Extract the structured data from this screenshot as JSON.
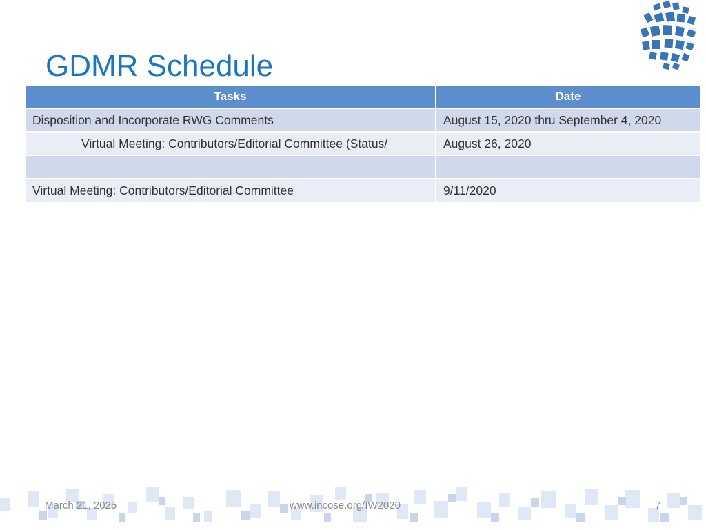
{
  "slide": {
    "title": "GDMR Schedule"
  },
  "table": {
    "headers": {
      "tasks": "Tasks",
      "date": "Date"
    },
    "rows": [
      {
        "task": "Disposition and Incorporate RWG Comments",
        "date": "August 15, 2020 thru September 4, 2020"
      },
      {
        "task": "Virtual Meeting: Contributors/Editorial Committee (Status/",
        "date": "August 26, 2020"
      },
      {
        "task": "",
        "date": ""
      },
      {
        "task": "Virtual Meeting: Contributors/Editorial Committee",
        "date": "9/11/2020"
      }
    ]
  },
  "footer": {
    "date": "March 21, 2025",
    "url": "www.incose.org/IW2020",
    "page_number": "7"
  },
  "colors": {
    "title": "#1a75c4",
    "header_bg": "#5b8ecb",
    "row_odd": "#d0d9eb",
    "row_even": "#e9edf6"
  },
  "icons": {
    "logo": "incose-globe-logo"
  }
}
